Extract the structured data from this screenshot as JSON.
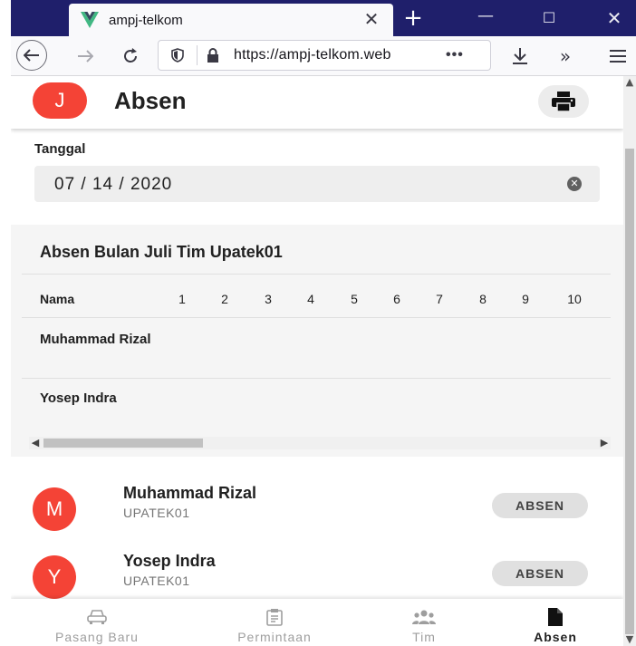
{
  "browser": {
    "tab_title": "ampj-telkom",
    "url": "https://ampj-telkom.web",
    "url_more": "•••",
    "new_tab": "+",
    "more": "»"
  },
  "app": {
    "avatar_letter": "J",
    "title": "Absen",
    "accent_color": "#f44336"
  },
  "date_filter": {
    "label": "Tanggal",
    "value": "07 / 14 / 2020"
  },
  "attendance_table": {
    "title": "Absen Bulan Juli Tim Upatek01",
    "name_header": "Nama",
    "day_headers": [
      "1",
      "2",
      "3",
      "4",
      "5",
      "6",
      "7",
      "8",
      "9",
      "10"
    ],
    "rows": [
      {
        "name": "Muhammad Rizal"
      },
      {
        "name": "Yosep Indra"
      }
    ]
  },
  "members": [
    {
      "initial": "M",
      "name": "Muhammad Rizal",
      "team": "UPATEK01",
      "action": "ABSEN"
    },
    {
      "initial": "Y",
      "name": "Yosep Indra",
      "team": "UPATEK01",
      "action": "ABSEN"
    }
  ],
  "bottom_nav": [
    {
      "label": "Pasang Baru",
      "icon": "car-icon",
      "active": false
    },
    {
      "label": "Permintaan",
      "icon": "clipboard-icon",
      "active": false
    },
    {
      "label": "Tim",
      "icon": "people-icon",
      "active": false
    },
    {
      "label": "Absen",
      "icon": "file-icon",
      "active": true
    }
  ]
}
